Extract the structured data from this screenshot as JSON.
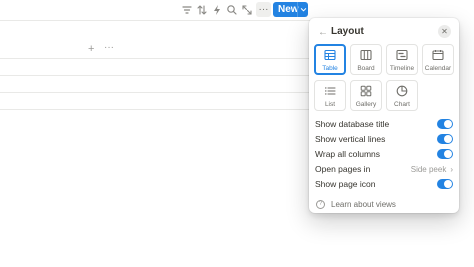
{
  "toolbar": {
    "icons": [
      "filter-icon",
      "sort-icon",
      "automation-bolt-icon",
      "search-icon",
      "expand-icon"
    ],
    "more_label": "···",
    "new_label": "New"
  },
  "table": {
    "add_column": "+",
    "column_more": "···"
  },
  "layout_panel": {
    "title": "Layout",
    "close_glyph": "✕",
    "back_glyph": "←",
    "layouts": [
      {
        "label": "Table",
        "icon": "table-icon",
        "selected": true
      },
      {
        "label": "Board",
        "icon": "board-icon",
        "selected": false
      },
      {
        "label": "Timeline",
        "icon": "timeline-icon",
        "selected": false
      },
      {
        "label": "Calendar",
        "icon": "calendar-icon",
        "selected": false
      },
      {
        "label": "List",
        "icon": "list-icon",
        "selected": false
      },
      {
        "label": "Gallery",
        "icon": "gallery-icon",
        "selected": false
      },
      {
        "label": "Chart",
        "icon": "chart-icon",
        "selected": false
      }
    ],
    "options": [
      {
        "label": "Show database title",
        "enabled": true
      },
      {
        "label": "Show vertical lines",
        "enabled": true
      },
      {
        "label": "Wrap all columns",
        "enabled": true
      },
      {
        "label": "Open pages in",
        "value": "Side peek"
      },
      {
        "label": "Show page icon",
        "enabled": true
      }
    ],
    "learn_label": "Learn about views"
  },
  "colors": {
    "accent": "#2383e2",
    "text": "#37352f",
    "muted": "#9b9a97",
    "border": "#e3e3e1"
  }
}
